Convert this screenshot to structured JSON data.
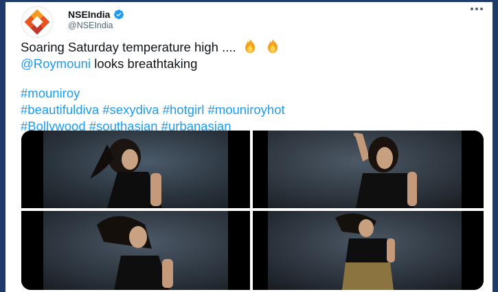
{
  "account": {
    "display_name": "NSEIndia",
    "handle": "@NSEIndia",
    "verified_icon": "verified-badge-icon",
    "avatar_icon": "nse-logo-icon"
  },
  "more_icon": "more-options-icon",
  "tweet": {
    "line1": "Soaring Saturday temperature high ....",
    "line1_emoji": "fire-emoji",
    "mention": "@Roymouni",
    "line2_rest": " looks breathtaking",
    "hashtags_line1": "#mouniroy",
    "hashtags_line2": "#beautifuldiva #sexydiva #hotgirl #mouniroyhot",
    "hashtags_line3": "#Bollywood #southasian #urbanasian"
  },
  "media": {
    "photos": [
      "photo-1",
      "photo-2",
      "photo-3",
      "photo-4"
    ]
  },
  "colors": {
    "link": "#1d9bf0",
    "frame": "#1d3a6b",
    "verified": "#1d9bf0"
  }
}
